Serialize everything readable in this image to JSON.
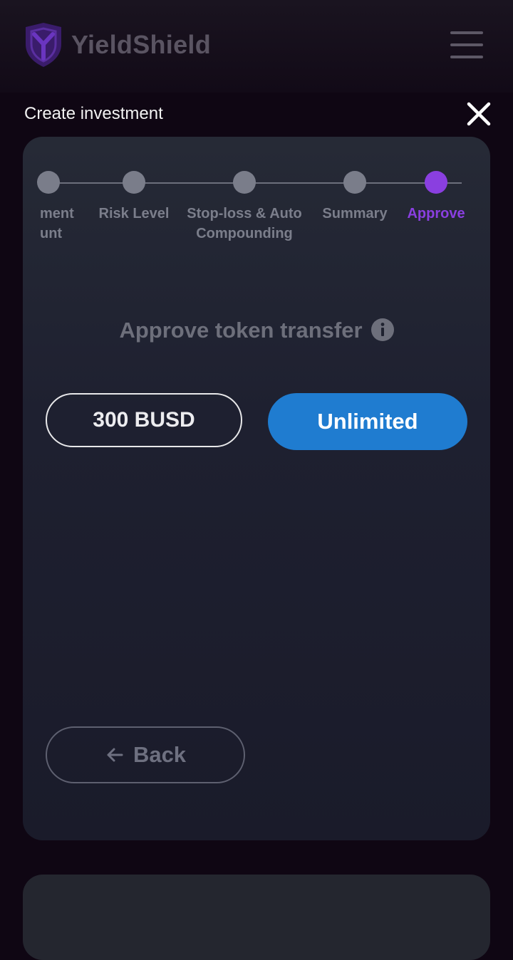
{
  "brand": {
    "name": "YieldShield",
    "accent": "#8a3fe0"
  },
  "header": {
    "menu_icon": "hamburger-menu-icon"
  },
  "modal": {
    "title": "Create investment",
    "close_icon": "close-icon",
    "steps": [
      {
        "line1": "ment",
        "line2": "unt",
        "state": "done"
      },
      {
        "line1": "Risk Level",
        "line2": "",
        "state": "done"
      },
      {
        "line1": "Stop-loss & Auto",
        "line2": "Compounding",
        "state": "done"
      },
      {
        "line1": "Summary",
        "line2": "",
        "state": "done"
      },
      {
        "line1": "Approve",
        "line2": "",
        "state": "active"
      }
    ],
    "heading": "Approve token transfer",
    "info_icon": "info-icon",
    "amount_button": "300 BUSD",
    "unlimited_button": "Unlimited",
    "back_button": "Back",
    "back_icon": "arrow-left-icon"
  },
  "colors": {
    "primary_button": "#1f7cd0",
    "active_step": "#8a3fe0"
  }
}
